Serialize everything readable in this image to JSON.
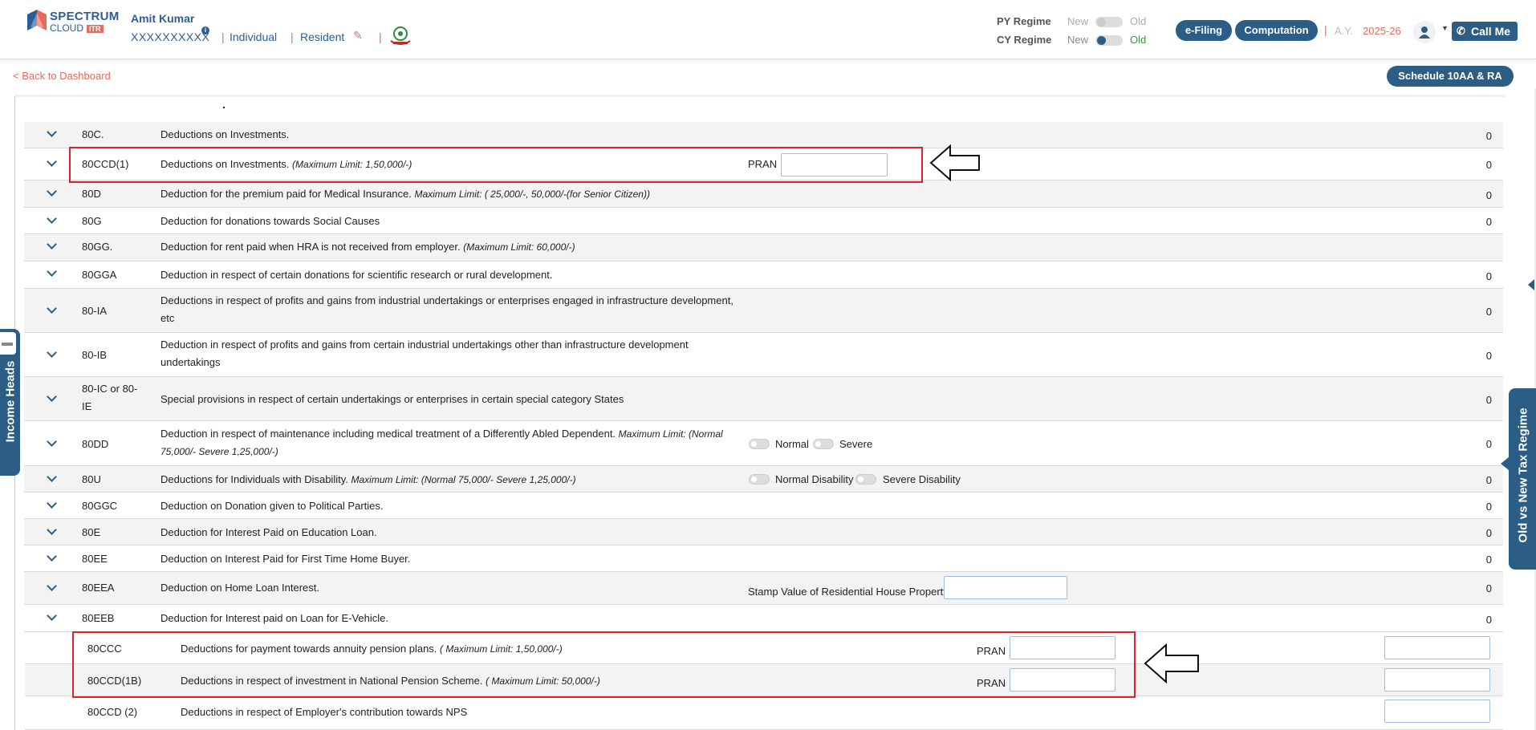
{
  "header": {
    "brand_line1": "SPECTRUM",
    "brand_line2": "CLOUD",
    "brand_badge": "ITR",
    "user_name": "Amit Kumar",
    "pan": "XXXXXXXXXX",
    "taxpayer_type": "Individual",
    "residency": "Resident",
    "py_regime_label": "PY Regime",
    "cy_regime_label": "CY Regime",
    "new_label": "New",
    "old_label": "Old",
    "efiling_label": "e-Filing",
    "computation_label": "Computation",
    "ay_label": "A.Y.",
    "ay_value": "2025-26",
    "call_me_label": "Call Me",
    "colors": {
      "primary": "#2c5d85",
      "accent": "#e86a5a",
      "active_green": "#2e9c3c"
    }
  },
  "subheader": {
    "back_label": "< Back to Dashboard",
    "schedule_label": "Schedule 10AA & RA"
  },
  "side_tabs": {
    "left": "Income Heads",
    "right": "Old vs New Tax Regime"
  },
  "rows": [
    {
      "code": "80C.",
      "desc": "Deductions on Investments.",
      "note": "",
      "amount": "0"
    },
    {
      "code": "80CCD(1)",
      "desc": "Deductions on Investments.",
      "note": "(Maximum Limit: 1,50,000/-)",
      "field_label": "PRAN",
      "amount": "0"
    },
    {
      "code": "80D",
      "desc": "Deduction for the premium paid for Medical Insurance.",
      "note": "Maximum Limit: ( 25,000/-, 50,000/-(for Senior Citizen))",
      "amount": "0"
    },
    {
      "code": "80G",
      "desc": "Deduction for donations towards Social Causes",
      "note": "",
      "amount": "0"
    },
    {
      "code": "80GG.",
      "desc": "Deduction for rent paid when HRA is not received from employer.",
      "note": "(Maximum Limit: 60,000/-)",
      "amount": ""
    },
    {
      "code": "80GGA",
      "desc": "Deduction in respect of certain donations for scientific research or rural development.",
      "note": "",
      "amount": "0"
    },
    {
      "code": "80-IA",
      "desc": "Deductions in respect of profits and gains from industrial undertakings or enterprises engaged in infrastructure development, etc",
      "note": "",
      "amount": "0"
    },
    {
      "code": "80-IB",
      "desc": "Deduction in respect of profits and gains from certain industrial undertakings other than infrastructure development undertakings",
      "note": "",
      "amount": "0"
    },
    {
      "code": "80-IC or 80-IE",
      "desc": "Special provisions in respect of certain undertakings or enterprises in certain special category States",
      "note": "",
      "amount": "0"
    },
    {
      "code": "80DD",
      "desc": "Deduction in respect of maintenance including medical treatment of a Differently Abled Dependent.",
      "note": "Maximum Limit: (Normal 75,000/- Severe 1,25,000/-)",
      "toggle1": "Normal",
      "toggle2": "Severe",
      "amount": "0"
    },
    {
      "code": "80U",
      "desc": "Deductions for Individuals with Disability.",
      "note": "Maximum Limit: (Normal 75,000/- Severe 1,25,000/-)",
      "toggle1": "Normal Disability",
      "toggle2": "Severe Disability",
      "amount": "0"
    },
    {
      "code": "80GGC",
      "desc": "Deduction on Donation given to Political Parties.",
      "note": "",
      "amount": "0"
    },
    {
      "code": "80E",
      "desc": "Deduction for Interest Paid on Education Loan.",
      "note": "",
      "amount": "0"
    },
    {
      "code": "80EE",
      "desc": "Deduction on Interest Paid for First Time Home Buyer.",
      "note": "",
      "amount": "0"
    },
    {
      "code": "80EEA",
      "desc": "Deduction on Home Loan Interest.",
      "note": "",
      "field_label": "Stamp Value of Residential House Property",
      "amount": "0"
    },
    {
      "code": "80EEB",
      "desc": "Deduction for Interest paid on Loan for E-Vehicle.",
      "note": "",
      "amount": "0"
    }
  ],
  "subrows": [
    {
      "code": "80CCC",
      "desc": "Deductions for payment towards annuity pension plans.",
      "note": "( Maximum Limit: 1,50,000/-)",
      "field_label": "PRAN"
    },
    {
      "code": "80CCD(1B)",
      "desc": "Deductions in respect of investment in National Pension Scheme.",
      "note": "( Maximum Limit: 50,000/-)",
      "field_label": "PRAN"
    },
    {
      "code": "80CCD (2)",
      "desc": "Deductions in respect of Employer's contribution towards NPS",
      "note": ""
    }
  ]
}
